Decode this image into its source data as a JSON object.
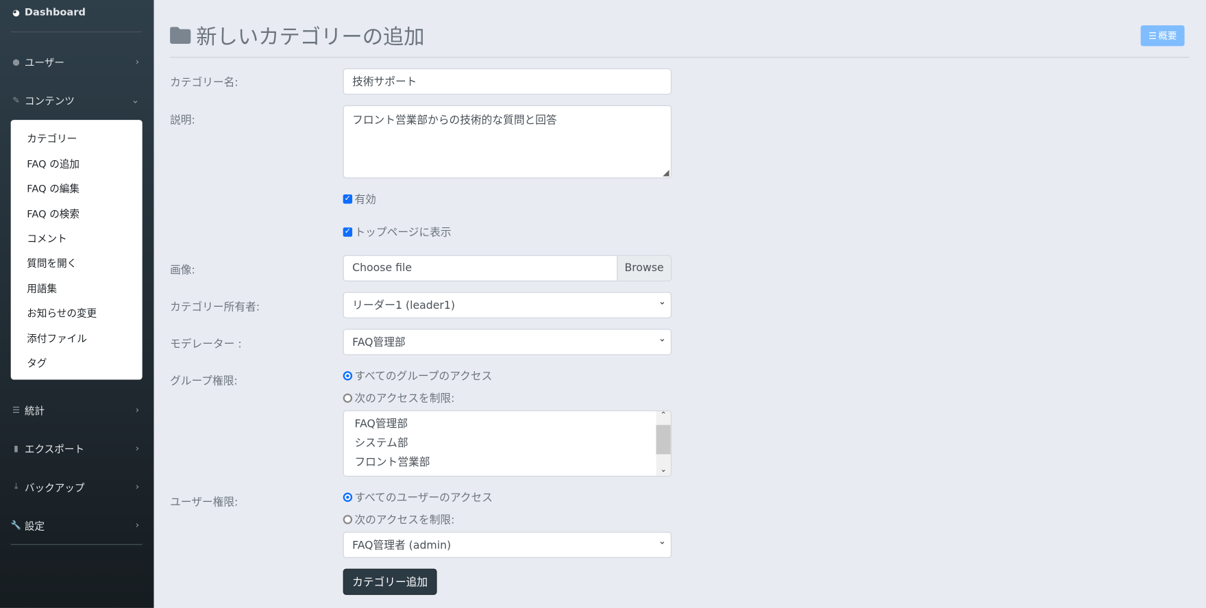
{
  "sidebar": {
    "dashboard": "Dashboard",
    "items": [
      {
        "label": "ユーザー",
        "icon": "user-icon"
      },
      {
        "label": "コンテンツ",
        "icon": "edit-icon"
      },
      {
        "label": "統計",
        "icon": "stats-icon"
      },
      {
        "label": "エクスポート",
        "icon": "file-icon"
      },
      {
        "label": "バックアップ",
        "icon": "download-icon"
      },
      {
        "label": "設定",
        "icon": "wrench-icon"
      }
    ],
    "submenu": [
      "カテゴリー",
      "FAQ の追加",
      "FAQ の編集",
      "FAQ の検索",
      "コメント",
      "質問を開く",
      "用語集",
      "お知らせの変更",
      "添付ファイル",
      "タグ"
    ]
  },
  "header": {
    "title": "新しいカテゴリーの追加",
    "overview_button": "概要"
  },
  "form": {
    "name_label": "カテゴリー名:",
    "name_value": "技術サポート",
    "desc_label": "説明:",
    "desc_value": "フロント営業部からの技術的な質問と回答",
    "active_label": "有効",
    "active_checked": true,
    "toppage_label": "トップページに表示",
    "toppage_checked": true,
    "image_label": "画像:",
    "image_placeholder": "Choose file",
    "browse": "Browse",
    "owner_label": "カテゴリー所有者:",
    "owner_value": "リーダー1 (leader1)",
    "moderator_label": "モデレーター :",
    "moderator_value": "FAQ管理部",
    "group_label": "グループ権限:",
    "group_all": "すべてのグループのアクセス",
    "group_restrict": "次のアクセスを制限:",
    "groups": [
      "FAQ管理部",
      "システム部",
      "フロント営業部"
    ],
    "user_label": "ユーザー権限:",
    "user_all": "すべてのユーザーのアクセス",
    "user_restrict": "次のアクセスを制限:",
    "user_value": "FAQ管理者 (admin)",
    "submit": "カテゴリー追加"
  },
  "colors": {
    "accent": "#0d6efd",
    "overview_button": "#80bdff",
    "submit": "#2c3a44"
  }
}
